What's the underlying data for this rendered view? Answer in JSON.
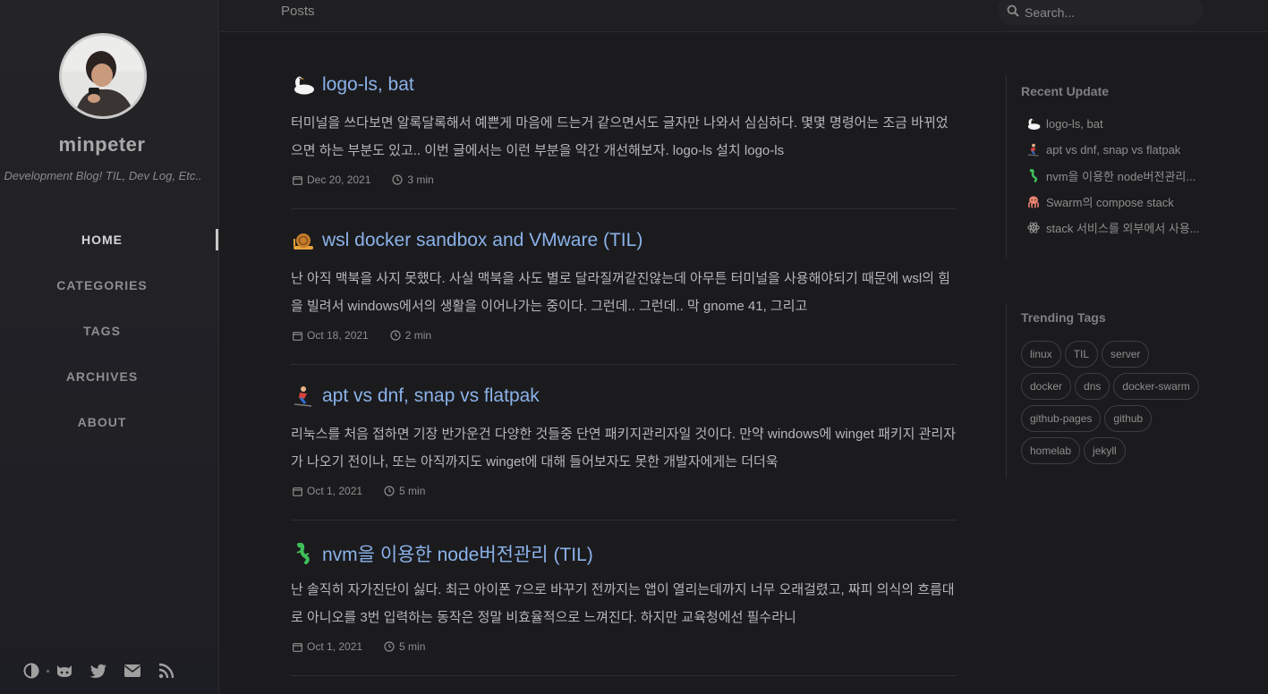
{
  "sidebar": {
    "site_title": "minpeter",
    "site_subtitle": "Development Blog! TIL, Dev Log, Etc..",
    "nav": [
      {
        "label": "HOME",
        "active": true
      },
      {
        "label": "CATEGORIES",
        "active": false
      },
      {
        "label": "TAGS",
        "active": false
      },
      {
        "label": "ARCHIVES",
        "active": false
      },
      {
        "label": "ABOUT",
        "active": false
      }
    ],
    "bottom_icons": [
      "theme-toggle-icon",
      "github-icon",
      "twitter-icon",
      "email-icon",
      "rss-icon"
    ]
  },
  "topbar": {
    "breadcrumb": "Posts",
    "search_placeholder": "Search..."
  },
  "posts": [
    {
      "emoji": "swan",
      "title": "logo-ls, bat",
      "excerpt": "터미널을 쓰다보면 알록달록해서 예쁜게 마음에 드는거 같으면서도 글자만 나와서 심심하다. 몇몇 명령어는 조금 바뀌었으면 하는 부분도 있고.. 이번 글에서는 이런 부분을 약간 개선해보자. logo-ls 설치 logo-ls",
      "date": "Dec 20, 2021",
      "read_time": "3 min"
    },
    {
      "emoji": "snail",
      "title": "wsl docker sandbox and VMware (TIL)",
      "excerpt": "난 아직 맥북을 사지 못했다. 사실 맥북을 사도 별로 달라질꺼같진않는데 아무튼 터미널을 사용해야되기 때문에 wsl의 힘을 빌려서 windows에서의 생활을 이어나가는 중이다. 그런데.. 그런데.. 막 gnome 41, 그리고",
      "date": "Oct 18, 2021",
      "read_time": "2 min"
    },
    {
      "emoji": "skier",
      "title": "apt vs dnf, snap vs flatpak",
      "excerpt": "리눅스를 처음 접하면 기장 반가운건 다양한 것들중 단연 패키지관리자일 것이다. 만약 windows에 winget 패키지 관리자가 나오기 전이나, 또는 아직까지도 winget에 대해 들어보자도 못한 개발자에게는 더더욱",
      "date": "Oct 1, 2021",
      "read_time": "5 min"
    },
    {
      "emoji": "lizard",
      "title": "nvm을 이용한 node버전관리 (TIL)",
      "excerpt": "난 솔직히 자가진단이 싫다. 최근 아이폰 7으로 바꾸기 전까지는 앱이 열리는데까지 너무 오래걸렸고, 짜피 의식의 흐름대로 아니오를 3번 입력하는 동작은 정말 비효율적으로 느껴진다. 하지만 교육청에선 필수라니",
      "date": "Oct 1, 2021",
      "read_time": "5 min"
    }
  ],
  "panel": {
    "recent_heading": "Recent Update",
    "recent": [
      {
        "emoji": "swan",
        "label": "logo-ls, bat"
      },
      {
        "emoji": "skier",
        "label": "apt vs dnf, snap vs flatpak"
      },
      {
        "emoji": "lizard",
        "label": "nvm을 이용한 node버전관리..."
      },
      {
        "emoji": "octopus",
        "label": "Swarm의 compose stack"
      },
      {
        "emoji": "atom",
        "label": "stack 서비스를 외부에서 사용..."
      }
    ],
    "tags_heading": "Trending Tags",
    "tags": [
      [
        "linux",
        "TIL",
        "server"
      ],
      [
        "docker",
        "dns",
        "docker-swarm"
      ],
      [
        "github-pages",
        "github"
      ],
      [
        "homelab",
        "jekyll"
      ]
    ]
  },
  "colors": {
    "background": "#1b1b1e",
    "sidebar": "#242427",
    "link": "#8bb2e9",
    "text": "#b6b7b8",
    "muted": "#8e8e8e"
  }
}
